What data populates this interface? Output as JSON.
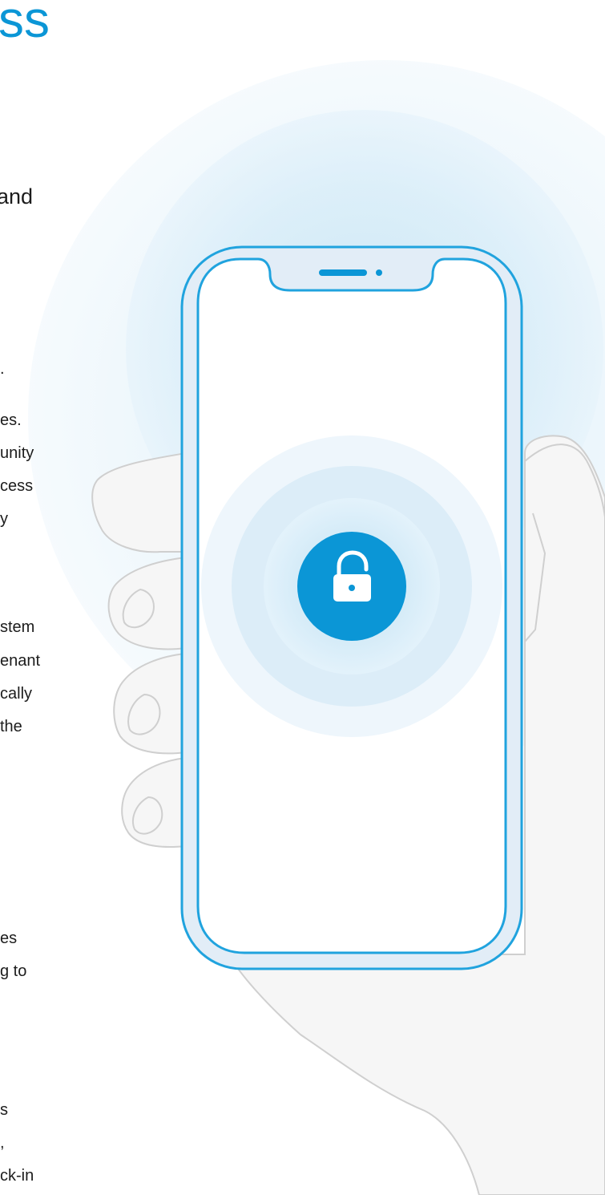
{
  "headline_fragment": "ss",
  "subhead_fragment": "and",
  "paragraphs": [
    {
      "lines": [
        ".",
        "es.",
        "unity",
        "cess",
        "y"
      ]
    },
    {
      "lines": [
        "stem",
        "enant",
        "cally",
        "the"
      ]
    },
    {
      "lines": [
        "es",
        "g to"
      ]
    },
    {
      "lines": [
        "s",
        ",",
        "ck-in"
      ]
    }
  ],
  "colors": {
    "brand_blue": "#0b96d6",
    "text": "#1c1c1c",
    "hand_fill": "#f6f6f6",
    "hand_stroke": "#cfcfcf",
    "phone_outline": "#20a3de",
    "phone_bezel": "#e2edf7"
  },
  "icons": {
    "center_icon": "unlock-icon"
  }
}
